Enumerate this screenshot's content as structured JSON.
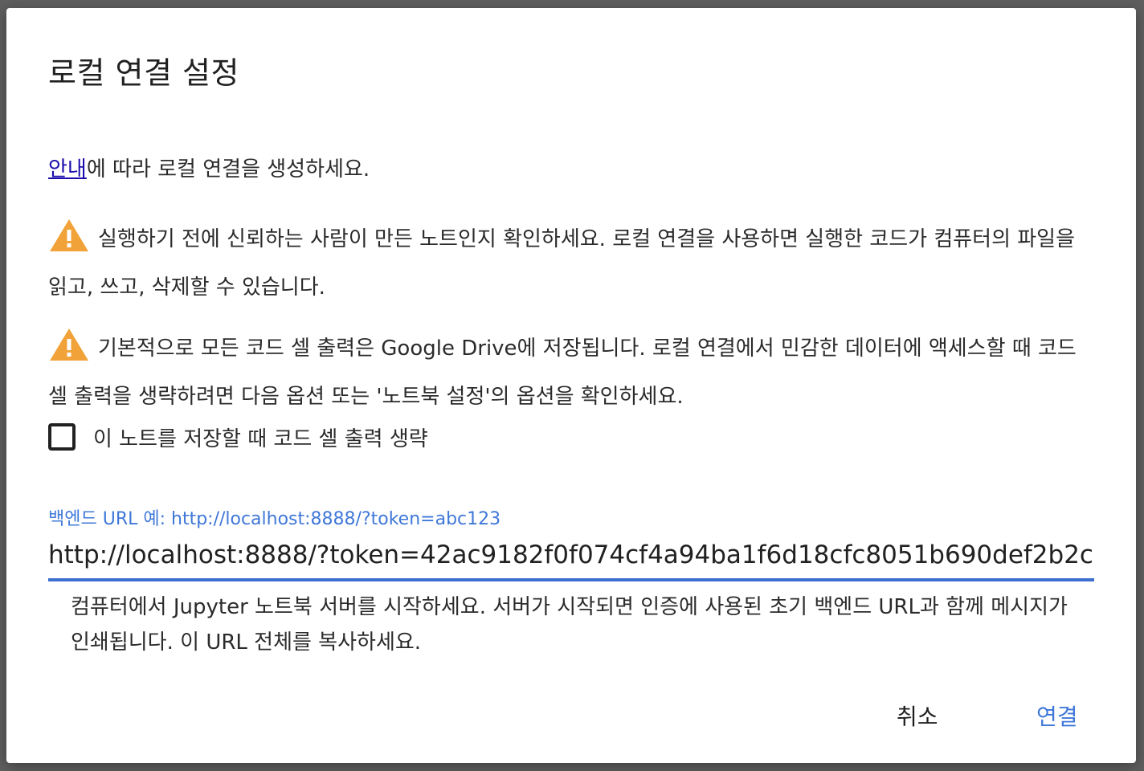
{
  "dialog": {
    "title": "로컬 연결 설정",
    "intro": {
      "link_text": "안내",
      "text": "에 따라 로컬 연결을 생성하세요."
    },
    "warning1": "실행하기 전에 신뢰하는 사람이 만든 노트인지 확인하세요. 로컬 연결을 사용하면 실행한 코드가 컴퓨터의 파일을 읽고, 쓰고, 삭제할 수 있습니다.",
    "warning2": "기본적으로 모든 코드 셀 출력은 Google Drive에 저장됩니다. 로컬 연결에서 민감한 데이터에 액세스할 때 코드 셀 출력을 생략하려면 다음 옵션 또는 '노트북 설정'의 옵션을 확인하세요.",
    "checkbox": {
      "label": "이 노트를 저장할 때 코드 셀 출력 생략",
      "checked": false
    },
    "backend_field": {
      "label": "백엔드 URL 예: http://localhost:8888/?token=abc123",
      "value": "http://localhost:8888/?token=42ac9182f0f074cf4a94ba1f6d18cfc8051b690def2b2c"
    },
    "helper_text": "컴퓨터에서 Jupyter 노트북 서버를 시작하세요. 서버가 시작되면 인증에 사용된 초기 백엔드 URL과 함께 메시지가 인쇄됩니다. 이 URL 전체를 복사하세요.",
    "buttons": {
      "cancel": "취소",
      "connect": "연결"
    }
  },
  "colors": {
    "accent": "#3f78d8",
    "warning_icon": "#f1a339",
    "link": "#1a0dab"
  },
  "icons": {
    "warning": "warning-triangle-icon"
  }
}
